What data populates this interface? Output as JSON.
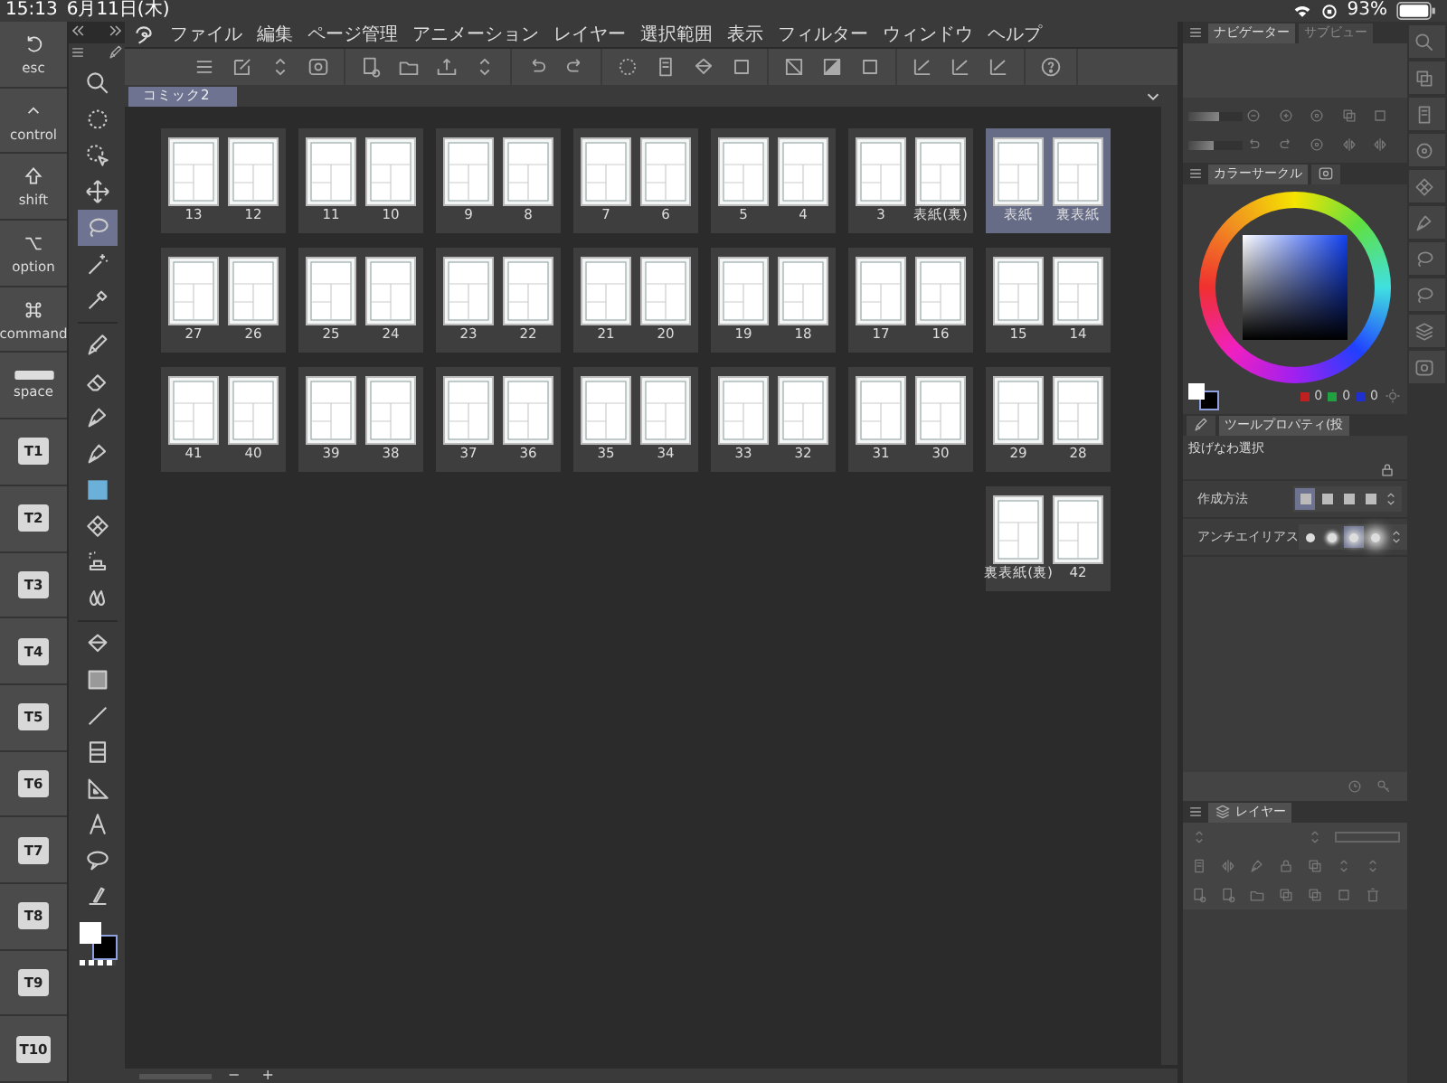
{
  "status_bar": {
    "time": "15:13",
    "date": "6月11日(木)",
    "battery": "93%"
  },
  "modifier_keys": [
    {
      "label": "esc",
      "kind": "esc"
    },
    {
      "label": "control",
      "kind": "control"
    },
    {
      "label": "shift",
      "kind": "shift"
    },
    {
      "label": "option",
      "kind": "option"
    },
    {
      "label": "command",
      "kind": "command"
    },
    {
      "label": "space",
      "kind": "space"
    }
  ],
  "shortcut_keys": [
    "T1",
    "T2",
    "T3",
    "T4",
    "T5",
    "T6",
    "T7",
    "T8",
    "T9",
    "T10"
  ],
  "tools": [
    {
      "selected": false
    },
    {
      "selected": false
    },
    {
      "selected": false
    },
    {
      "selected": false
    },
    {
      "selected": true
    },
    {
      "selected": false
    },
    {
      "selected": false
    },
    {
      "selected": false
    },
    {
      "selected": false
    },
    {
      "selected": false
    },
    {
      "selected": false
    },
    {
      "selected": false
    },
    {
      "selected": false
    },
    {
      "selected": false
    },
    {
      "selected": false
    },
    {
      "selected": false
    },
    {
      "selected": false
    },
    {
      "selected": false
    },
    {
      "selected": false
    },
    {
      "selected": false
    },
    {
      "selected": false
    },
    {
      "selected": false
    },
    {
      "selected": false
    }
  ],
  "menu": [
    "ファイル",
    "編集",
    "ページ管理",
    "アニメーション",
    "レイヤー",
    "選択範囲",
    "表示",
    "フィルター",
    "ウィンドウ",
    "ヘルプ"
  ],
  "document_tab": {
    "title": "コミック2"
  },
  "spread_rows": [
    {
      "spreads": [
        {
          "pages": [
            "13",
            "12"
          ],
          "selected": false
        },
        {
          "pages": [
            "11",
            "10"
          ],
          "selected": false
        },
        {
          "pages": [
            "9",
            "8"
          ],
          "selected": false
        },
        {
          "pages": [
            "7",
            "6"
          ],
          "selected": false
        },
        {
          "pages": [
            "5",
            "4"
          ],
          "selected": false
        },
        {
          "pages": [
            "3",
            "表紙(裏)"
          ],
          "selected": false
        },
        {
          "pages": [
            "表紙",
            "裏表紙"
          ],
          "selected": true
        }
      ]
    },
    {
      "spreads": [
        {
          "pages": [
            "27",
            "26"
          ],
          "selected": false
        },
        {
          "pages": [
            "25",
            "24"
          ],
          "selected": false
        },
        {
          "pages": [
            "23",
            "22"
          ],
          "selected": false
        },
        {
          "pages": [
            "21",
            "20"
          ],
          "selected": false
        },
        {
          "pages": [
            "19",
            "18"
          ],
          "selected": false
        },
        {
          "pages": [
            "17",
            "16"
          ],
          "selected": false
        },
        {
          "pages": [
            "15",
            "14"
          ],
          "selected": false
        }
      ]
    },
    {
      "spreads": [
        {
          "pages": [
            "41",
            "40"
          ],
          "selected": false
        },
        {
          "pages": [
            "39",
            "38"
          ],
          "selected": false
        },
        {
          "pages": [
            "37",
            "36"
          ],
          "selected": false
        },
        {
          "pages": [
            "35",
            "34"
          ],
          "selected": false
        },
        {
          "pages": [
            "33",
            "32"
          ],
          "selected": false
        },
        {
          "pages": [
            "31",
            "30"
          ],
          "selected": false
        },
        {
          "pages": [
            "29",
            "28"
          ],
          "selected": false
        }
      ]
    },
    {
      "spreads": [
        {
          "pages": [
            "裏表紙(裏)",
            "42"
          ],
          "selected": false
        }
      ]
    }
  ],
  "navigator": {
    "tabs": [
      {
        "label": "ナビゲーター",
        "selected": true
      },
      {
        "label": "サブビュー",
        "selected": false
      }
    ],
    "sliders": [
      {
        "level": 0.55
      },
      {
        "level": 0.45
      }
    ]
  },
  "color_panel": {
    "tab": "カラーサークル",
    "rgb": [
      "0",
      "0",
      "0"
    ]
  },
  "tool_property": {
    "tab": "ツールプロパティ(投",
    "subtool": "投げなわ選択",
    "rows": [
      {
        "label": "作成方法",
        "kind": "squares",
        "options": [
          {
            "selected": true
          },
          {
            "selected": false
          },
          {
            "selected": false
          },
          {
            "selected": false
          }
        ]
      },
      {
        "label": "アンチエイリアス",
        "kind": "circles",
        "options": [
          {
            "selected": false
          },
          {
            "selected": false
          },
          {
            "selected": true
          },
          {
            "selected": false
          }
        ]
      }
    ]
  },
  "layer_panel": {
    "tab": "レイヤー"
  },
  "bottom_bar": {
    "zoom_out": "−",
    "zoom_in": "+"
  }
}
